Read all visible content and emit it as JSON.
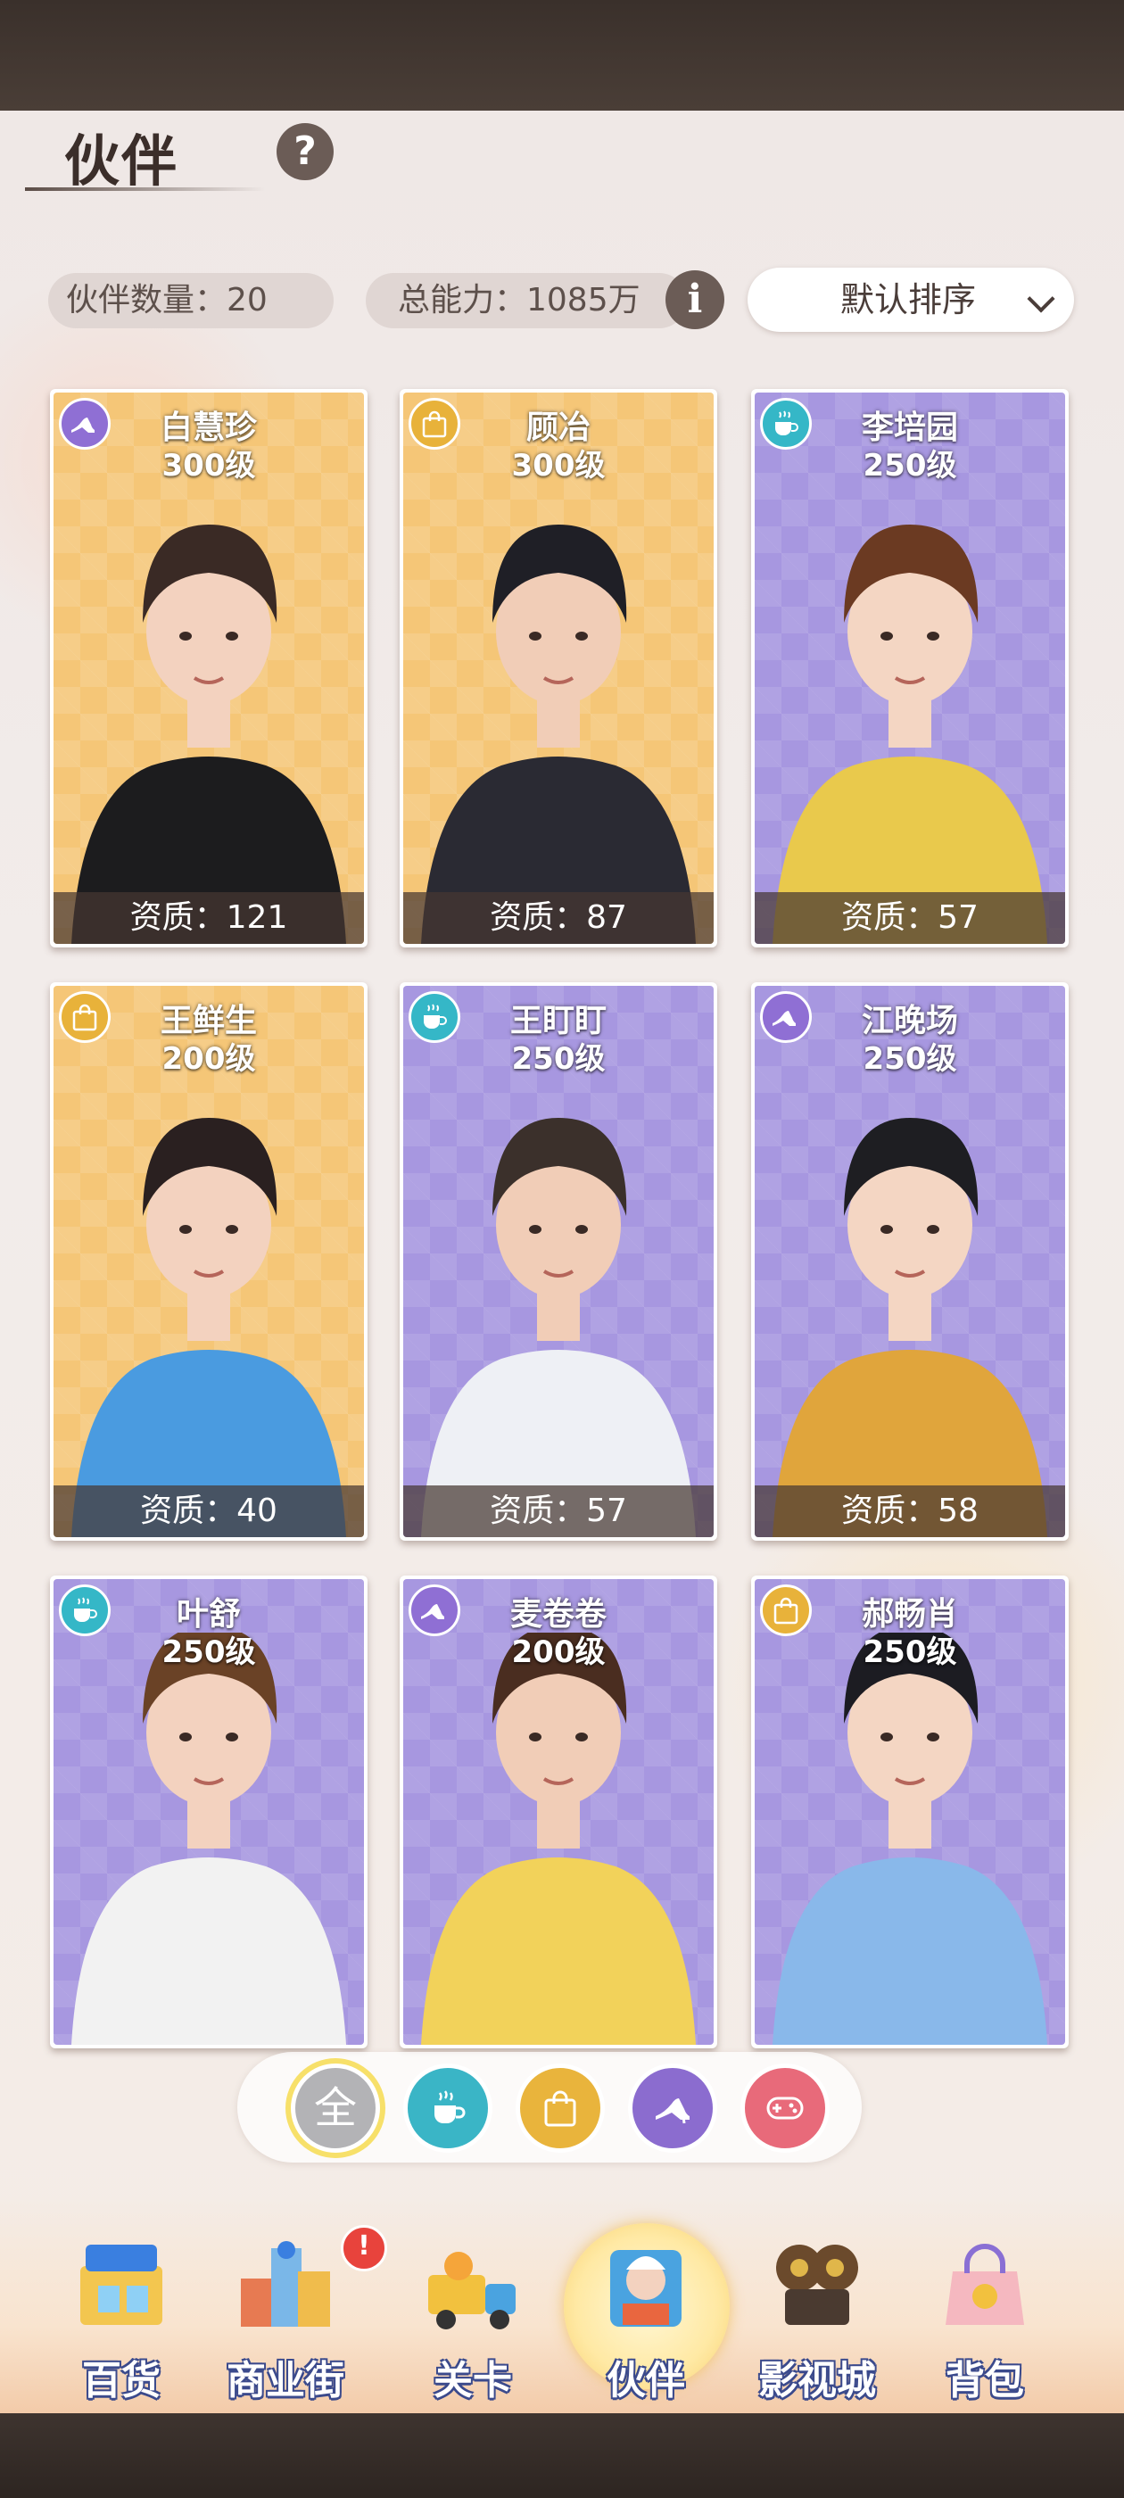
{
  "header": {
    "title": "伙伴",
    "help_icon": "question-mark-icon"
  },
  "stats": {
    "partner_count_label": "伙伴数量：20",
    "total_power_label": "总能力：1085万",
    "info_icon": "info-icon"
  },
  "sort": {
    "selected": "默认排序"
  },
  "cards": [
    {
      "name": "白慧珍",
      "level": "300级",
      "aptitude": "资质：121",
      "category": "heel",
      "theme": "yellow"
    },
    {
      "name": "顾冶",
      "level": "300级",
      "aptitude": "资质：87",
      "category": "bag",
      "theme": "yellow"
    },
    {
      "name": "李培园",
      "level": "250级",
      "aptitude": "资质：57",
      "category": "cup",
      "theme": "purple"
    },
    {
      "name": "王鲜生",
      "level": "200级",
      "aptitude": "资质：40",
      "category": "bag",
      "theme": "yellow"
    },
    {
      "name": "王盯盯",
      "level": "250级",
      "aptitude": "资质：57",
      "category": "cup",
      "theme": "purple"
    },
    {
      "name": "江晚场",
      "level": "250级",
      "aptitude": "资质：58",
      "category": "heel",
      "theme": "purple"
    },
    {
      "name": "叶舒",
      "level": "250级",
      "aptitude": "",
      "category": "cup",
      "theme": "purple"
    },
    {
      "name": "麦卷卷",
      "level": "200级",
      "aptitude": "",
      "category": "heel",
      "theme": "purple"
    },
    {
      "name": "郝畅肖",
      "level": "250级",
      "aptitude": "",
      "category": "bag",
      "theme": "purple"
    }
  ],
  "filters": [
    {
      "label": "全",
      "icon": "all-icon",
      "selected": true
    },
    {
      "label": "",
      "icon": "cup-icon",
      "selected": false
    },
    {
      "label": "",
      "icon": "bag-icon",
      "selected": false
    },
    {
      "label": "",
      "icon": "heel-icon",
      "selected": false
    },
    {
      "label": "",
      "icon": "gamepad-icon",
      "selected": false
    }
  ],
  "nav": {
    "items": [
      {
        "label": "百货",
        "icon": "department-store-icon"
      },
      {
        "label": "商业街",
        "icon": "commercial-street-icon",
        "badge": "!"
      },
      {
        "label": "关卡",
        "icon": "truck-icon"
      },
      {
        "label": "伙伴",
        "icon": "partner-icon",
        "active": true
      },
      {
        "label": "影视城",
        "icon": "film-city-icon"
      },
      {
        "label": "背包",
        "icon": "backpack-icon"
      }
    ]
  },
  "colors": {
    "card_yellow": "#f5c677",
    "card_purple": "#a797e0",
    "heel": "#8f6fd4",
    "bag": "#e8b23a",
    "cup": "#35b7c7",
    "game": "#e86a7a"
  }
}
